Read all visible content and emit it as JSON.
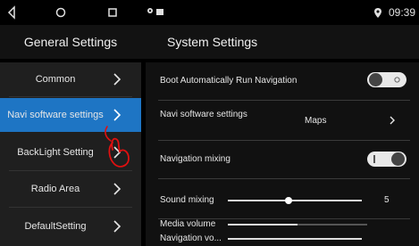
{
  "status_bar": {
    "time": "09:39",
    "nav_icons": [
      "back-icon",
      "home-icon",
      "recent-apps-icon"
    ],
    "indicator_icons": [
      "location-pin-icon",
      "notification-icon"
    ]
  },
  "header": {
    "left_title": "General Settings",
    "right_title": "System Settings"
  },
  "sidebar": {
    "active_index": 1,
    "items": [
      {
        "label": "Common"
      },
      {
        "label": "Navi software settings"
      },
      {
        "label": "BackLight Setting"
      },
      {
        "label": "Radio Area"
      },
      {
        "label": "DefaultSetting"
      }
    ]
  },
  "main": {
    "boot_nav": {
      "label": "Boot Automatically Run Navigation",
      "toggle": "off"
    },
    "navi_software": {
      "label": "Navi software settings",
      "value": "Maps"
    },
    "nav_mixing": {
      "label": "Navigation mixing",
      "toggle": "on"
    },
    "sound_mixing": {
      "label": "Sound mixing",
      "value": "5",
      "level": 0.45
    },
    "media_volume": {
      "label": "Media volume"
    },
    "navigation_volume": {
      "label": "Navigation vo..."
    }
  },
  "colors": {
    "accent": "#1e75c4",
    "annotation": "#e01010"
  }
}
